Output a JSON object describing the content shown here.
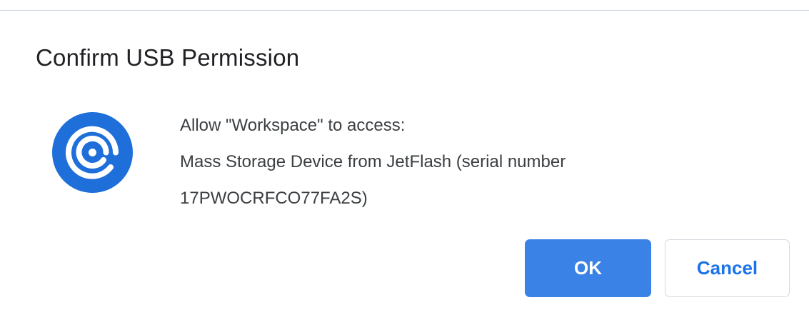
{
  "dialog": {
    "title": "Confirm USB Permission",
    "app_icon": "workspace-app-icon",
    "message": {
      "line1": "Allow \"Workspace\" to access:",
      "line2": "Mass Storage Device from JetFlash (serial number",
      "line3": "17PWOCRFCO77FA2S)"
    },
    "buttons": {
      "ok_label": "OK",
      "cancel_label": "Cancel"
    }
  },
  "colors": {
    "ok_button": "#3b82e6",
    "cancel_text": "#1a73e8",
    "icon_blue": "#1e6fd9"
  }
}
